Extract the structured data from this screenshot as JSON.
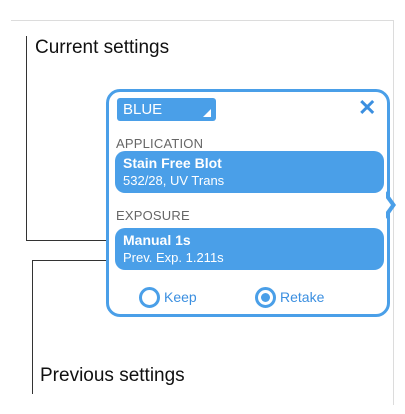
{
  "callouts": {
    "current_label": "Current settings",
    "previous_label": "Previous settings"
  },
  "popup": {
    "channel_select": {
      "value": "BLUE",
      "icon": "dropdown-corner-icon"
    },
    "close_icon": "close-icon",
    "close_glyph": "✕",
    "application": {
      "title": "APPLICATION",
      "primary": "Stain Free Blot",
      "secondary": "532/28, UV Trans"
    },
    "exposure": {
      "title": "EXPOSURE",
      "primary": "Manual 1s",
      "secondary": "Prev. Exp. 1.211s"
    },
    "options": [
      {
        "label": "Keep",
        "selected": false
      },
      {
        "label": "Retake",
        "selected": true
      }
    ],
    "colors": {
      "accent": "#4a9fe8",
      "accent_text": "#3b8fe0"
    }
  }
}
